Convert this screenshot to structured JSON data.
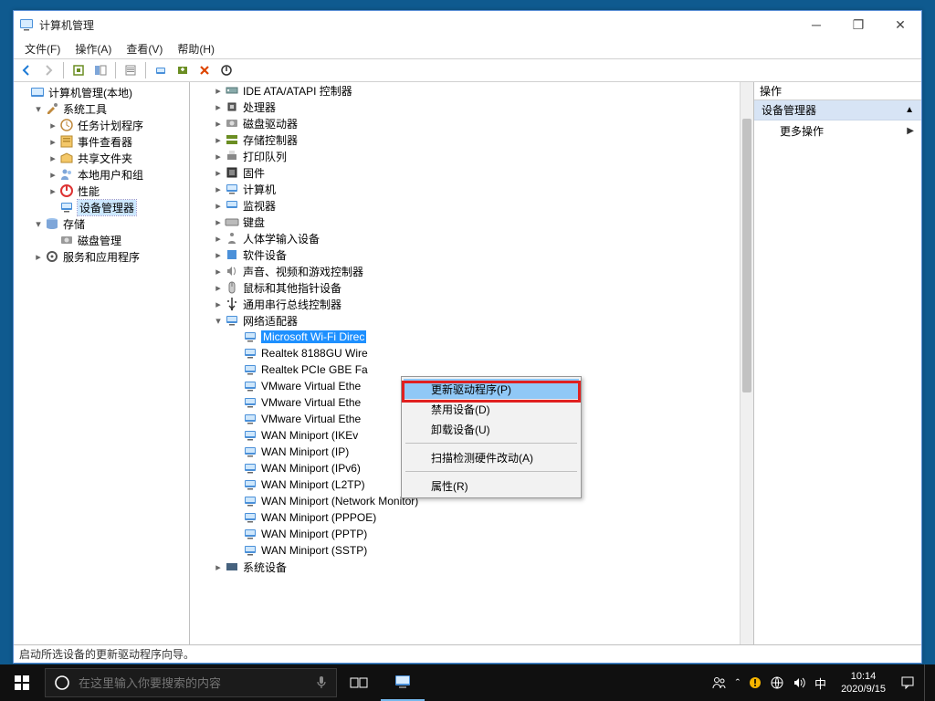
{
  "window": {
    "title": "计算机管理",
    "menus": [
      "文件(F)",
      "操作(A)",
      "查看(V)",
      "帮助(H)"
    ],
    "status": "启动所选设备的更新驱动程序向导。"
  },
  "left_tree": [
    {
      "ind": 0,
      "tw": "",
      "icon": "mgmt",
      "label": "计算机管理(本地)"
    },
    {
      "ind": 1,
      "tw": "▾",
      "icon": "tools",
      "label": "系统工具"
    },
    {
      "ind": 2,
      "tw": "▸",
      "icon": "sched",
      "label": "任务计划程序"
    },
    {
      "ind": 2,
      "tw": "▸",
      "icon": "event",
      "label": "事件查看器"
    },
    {
      "ind": 2,
      "tw": "▸",
      "icon": "share",
      "label": "共享文件夹"
    },
    {
      "ind": 2,
      "tw": "▸",
      "icon": "users",
      "label": "本地用户和组"
    },
    {
      "ind": 2,
      "tw": "▸",
      "icon": "perf",
      "label": "性能"
    },
    {
      "ind": 2,
      "tw": "",
      "icon": "devmgr",
      "label": "设备管理器",
      "sel": true
    },
    {
      "ind": 1,
      "tw": "▾",
      "icon": "storage",
      "label": "存储"
    },
    {
      "ind": 2,
      "tw": "",
      "icon": "disk",
      "label": "磁盘管理"
    },
    {
      "ind": 1,
      "tw": "▸",
      "icon": "svc",
      "label": "服务和应用程序"
    }
  ],
  "device_tree": [
    {
      "ind": 0,
      "tw": "▸",
      "cat": "ide",
      "label": "IDE ATA/ATAPI 控制器"
    },
    {
      "ind": 0,
      "tw": "▸",
      "cat": "cpu",
      "label": "处理器"
    },
    {
      "ind": 0,
      "tw": "▸",
      "cat": "diskdrv",
      "label": "磁盘驱动器"
    },
    {
      "ind": 0,
      "tw": "▸",
      "cat": "storctl",
      "label": "存储控制器"
    },
    {
      "ind": 0,
      "tw": "▸",
      "cat": "printq",
      "label": "打印队列"
    },
    {
      "ind": 0,
      "tw": "▸",
      "cat": "firmware",
      "label": "固件"
    },
    {
      "ind": 0,
      "tw": "▸",
      "cat": "computer",
      "label": "计算机"
    },
    {
      "ind": 0,
      "tw": "▸",
      "cat": "monitor",
      "label": "监视器"
    },
    {
      "ind": 0,
      "tw": "▸",
      "cat": "keyboard",
      "label": "键盘"
    },
    {
      "ind": 0,
      "tw": "▸",
      "cat": "hid",
      "label": "人体学输入设备"
    },
    {
      "ind": 0,
      "tw": "▸",
      "cat": "software",
      "label": "软件设备"
    },
    {
      "ind": 0,
      "tw": "▸",
      "cat": "audio",
      "label": "声音、视频和游戏控制器"
    },
    {
      "ind": 0,
      "tw": "▸",
      "cat": "mouse",
      "label": "鼠标和其他指针设备"
    },
    {
      "ind": 0,
      "tw": "▸",
      "cat": "usb",
      "label": "通用串行总线控制器"
    },
    {
      "ind": 0,
      "tw": "▾",
      "cat": "network",
      "label": "网络适配器"
    },
    {
      "ind": 1,
      "tw": "",
      "cat": "nic",
      "label": "Microsoft Wi-Fi Direc",
      "sel": true
    },
    {
      "ind": 1,
      "tw": "",
      "cat": "nic",
      "label": "Realtek 8188GU Wire"
    },
    {
      "ind": 1,
      "tw": "",
      "cat": "nic",
      "label": "Realtek PCIe GBE Fa"
    },
    {
      "ind": 1,
      "tw": "",
      "cat": "nic",
      "label": "VMware Virtual Ethe"
    },
    {
      "ind": 1,
      "tw": "",
      "cat": "nic",
      "label": "VMware Virtual Ethe"
    },
    {
      "ind": 1,
      "tw": "",
      "cat": "nic",
      "label": "VMware Virtual Ethe"
    },
    {
      "ind": 1,
      "tw": "",
      "cat": "nic",
      "label": "WAN Miniport (IKEv"
    },
    {
      "ind": 1,
      "tw": "",
      "cat": "nic",
      "label": "WAN Miniport (IP)"
    },
    {
      "ind": 1,
      "tw": "",
      "cat": "nic",
      "label": "WAN Miniport (IPv6)"
    },
    {
      "ind": 1,
      "tw": "",
      "cat": "nic",
      "label": "WAN Miniport (L2TP)"
    },
    {
      "ind": 1,
      "tw": "",
      "cat": "nic",
      "label": "WAN Miniport (Network Monitor)"
    },
    {
      "ind": 1,
      "tw": "",
      "cat": "nic",
      "label": "WAN Miniport (PPPOE)"
    },
    {
      "ind": 1,
      "tw": "",
      "cat": "nic",
      "label": "WAN Miniport (PPTP)"
    },
    {
      "ind": 1,
      "tw": "",
      "cat": "nic",
      "label": "WAN Miniport (SSTP)"
    },
    {
      "ind": 0,
      "tw": "▸",
      "cat": "system",
      "label": "系统设备"
    }
  ],
  "context_menu": {
    "items": [
      {
        "label": "更新驱动程序(P)",
        "hl": true
      },
      {
        "label": "禁用设备(D)"
      },
      {
        "label": "卸载设备(U)"
      },
      {
        "sep": true
      },
      {
        "label": "扫描检测硬件改动(A)"
      },
      {
        "sep": true
      },
      {
        "label": "属性(R)"
      }
    ]
  },
  "right_pane": {
    "header": "操作",
    "section_title": "设备管理器",
    "more_actions": "更多操作"
  },
  "taskbar": {
    "search_placeholder": "在这里输入你要搜索的内容",
    "ime": "中",
    "time": "10:14",
    "date": "2020/9/15"
  }
}
